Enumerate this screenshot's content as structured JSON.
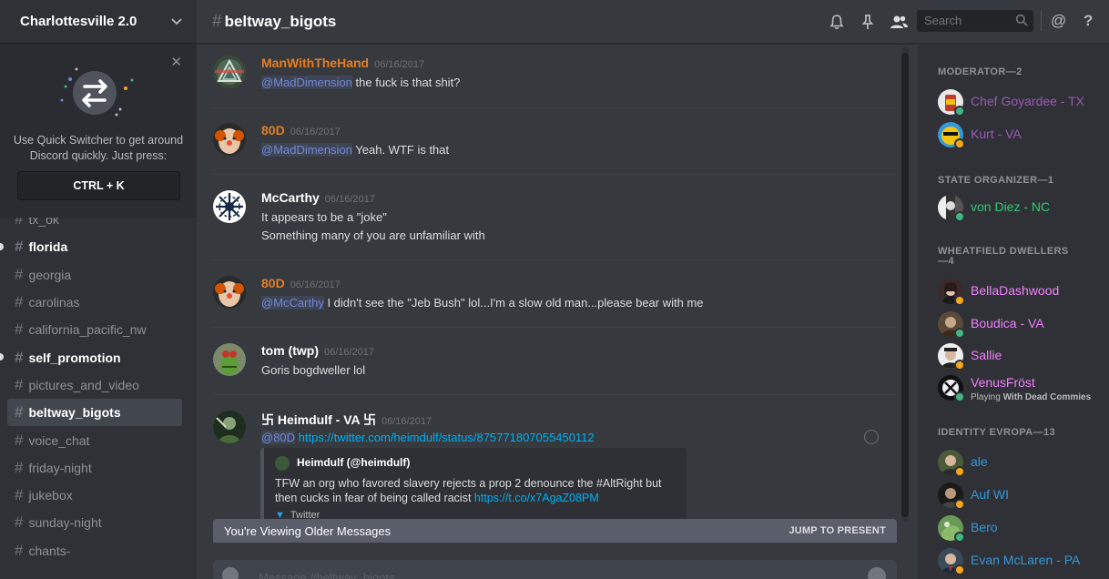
{
  "server": {
    "name": "Charlottesville 2.0"
  },
  "quick_switcher": {
    "line1": "Use Quick Switcher to get around",
    "line2": "Discord quickly. Just press:",
    "shortcut": "CTRL + K"
  },
  "channels": [
    {
      "name": "tx_ok"
    },
    {
      "name": "florida"
    },
    {
      "name": "georgia"
    },
    {
      "name": "carolinas"
    },
    {
      "name": "california_pacific_nw"
    },
    {
      "name": "self_promotion"
    },
    {
      "name": "pictures_and_video"
    },
    {
      "name": "beltway_bigots"
    },
    {
      "name": "voice_chat"
    },
    {
      "name": "friday-night"
    },
    {
      "name": "jukebox"
    },
    {
      "name": "sunday-night"
    },
    {
      "name": "chants-"
    }
  ],
  "header": {
    "channel_name": "beltway_bigots",
    "search_placeholder": "Search"
  },
  "messages": [
    {
      "author": "ManWithTheHand",
      "color": "#e67e22",
      "time": "06/16/2017",
      "mention": "@MadDimension",
      "text": " the fuck is that shit?"
    },
    {
      "author": "80D",
      "color": "#e67e22",
      "time": "06/16/2017",
      "mention": "@MadDimension",
      "text": " Yeah. WTF is that"
    },
    {
      "author": "McCarthy",
      "color": "#ffffff",
      "time": "06/16/2017",
      "line1": "It appears to be a \"joke\"",
      "line2": "Something many of you are unfamiliar with"
    },
    {
      "author": "80D",
      "color": "#e67e22",
      "time": "06/16/2017",
      "mention": "@McCarthy",
      "text": " I didn't see the \"Jeb Bush\" lol...I'm a slow old man...please bear with me"
    },
    {
      "author": "tom (twp)",
      "color": "#ffffff",
      "time": "06/16/2017",
      "text": "Goris bogdweller lol"
    },
    {
      "author": "卐 Heimdulf - VA 卐",
      "color": "#ffffff",
      "time": "06/16/2017",
      "mention": "@80D",
      "link": "https://twitter.com/heimdulf/status/875771807055450112"
    }
  ],
  "embed": {
    "author": "Heimdulf (@heimdulf)",
    "desc_line1": "TFW an org who favored slavery rejects a prop 2 denounce the #AltRight but then",
    "desc_line2": "cucks in fear of being called racist ",
    "desc_link": "https://t.co/x7AgaZ08PM",
    "footer": "Twitter"
  },
  "older_bar": {
    "text": "You're Viewing Older Messages",
    "jump": "JUMP TO PRESENT"
  },
  "composer": {
    "placeholder": "Message #beltway_bigots"
  },
  "member_groups": [
    {
      "title": "MODERATOR—2",
      "members": [
        {
          "name": "Chef Goyardee - TX",
          "color": "#9b59b6",
          "status": "online"
        },
        {
          "name": "Kurt - VA",
          "color": "#9b59b6",
          "status": "idle"
        }
      ]
    },
    {
      "title": "STATE ORGANIZER—1",
      "members": [
        {
          "name": "von Diez - NC",
          "color": "#2ecc71",
          "status": "online"
        }
      ]
    },
    {
      "title": "WHEATFIELD DWELLERS—4",
      "members": [
        {
          "name": "BellaDashwood",
          "color": "#f47fff",
          "status": "idle"
        },
        {
          "name": "Boudica - VA",
          "color": "#f47fff",
          "status": "online"
        },
        {
          "name": "Sallie",
          "color": "#f47fff",
          "status": "idle"
        },
        {
          "name": "VenusFröst",
          "color": "#f47fff",
          "status": "online",
          "game_prefix": "Playing ",
          "game": "With Dead Commies"
        }
      ]
    },
    {
      "title": "IDENTITY EVROPA—13",
      "members": [
        {
          "name": "ale",
          "color": "#3498db",
          "status": "idle"
        },
        {
          "name": "Auf WI",
          "color": "#3498db",
          "status": "idle"
        },
        {
          "name": "Bero",
          "color": "#3498db",
          "status": "online"
        },
        {
          "name": "Evan McLaren - PA",
          "color": "#3498db",
          "status": "idle"
        }
      ]
    }
  ],
  "colors": {
    "mention": "#7289da",
    "link": "#00b0f4",
    "sidebar_bg": "#2f3136",
    "chat_bg": "#36393e"
  }
}
